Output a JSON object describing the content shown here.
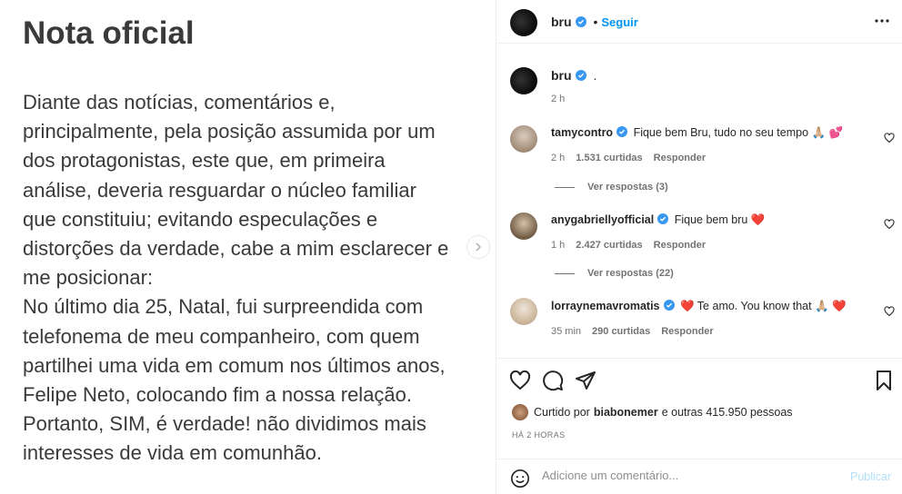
{
  "note": {
    "title": "Nota oficial",
    "lines": [
      "Diante das notícias, comentários e,",
      "principalmente, pela posição assumida por um",
      "dos protagonistas, este que, em primeira",
      "análise, deveria resguardar o núcleo familiar",
      "que constituiu; evitando especulações e",
      "distorções da verdade, cabe a mim esclarecer e",
      "me posicionar:",
      "No último dia 25, Natal, fui surpreendida com",
      "telefonema de meu companheiro, com quem",
      "partilhei uma vida em comum nos últimos anos,",
      "Felipe Neto, colocando fim a nossa relação.",
      "Portanto, SIM, é verdade! não dividimos mais",
      "interesses de vida em comunhão."
    ]
  },
  "header": {
    "username": "bru",
    "separator": "•",
    "follow_label": "Seguir",
    "more_icon": "more-horizontal-icon"
  },
  "caption": {
    "username": "bru",
    "text": ".",
    "time": "2 h"
  },
  "comments": [
    {
      "username": "tamycontro",
      "text": "Fique bem Bru, tudo no seu tempo 🙏🏼 💕",
      "time": "2 h",
      "likes": "1.531 curtidas",
      "reply_label": "Responder",
      "view_replies": "Ver respostas (3)"
    },
    {
      "username": "anygabriellyofficial",
      "text": "Fique bem bru ❤️",
      "time": "1 h",
      "likes": "2.427 curtidas",
      "reply_label": "Responder",
      "view_replies": "Ver respostas (22)"
    },
    {
      "username": "lorraynemavromatis",
      "text": "❤️ Te amo. You know that 🙏🏼 ❤️",
      "time": "35 min",
      "likes": "290 curtidas",
      "reply_label": "Responder"
    }
  ],
  "actions": {
    "like_icon": "heart-icon",
    "comment_icon": "comment-icon",
    "share_icon": "share-icon",
    "save_icon": "bookmark-icon"
  },
  "likes": {
    "prefix": "Curtido por",
    "user": "biabonemer",
    "suffix": "e outras 415.950 pessoas"
  },
  "timestamp": "HÁ 2 HORAS",
  "comment_bar": {
    "emoji_icon": "emoji-icon",
    "placeholder": "Adicione um comentário...",
    "publish_label": "Publicar"
  },
  "colors": {
    "accent": "#0095f6",
    "verified": "#3897f0",
    "publish_disabled": "#b2dffc",
    "heart_red": "#ed4956"
  }
}
